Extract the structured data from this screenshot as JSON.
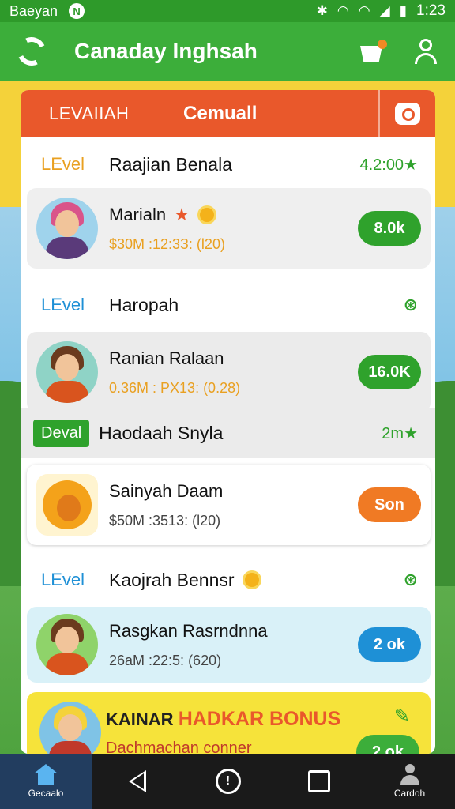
{
  "status": {
    "carrier": "Baeyan",
    "time": "1:23",
    "nfc_icon": "N"
  },
  "appbar": {
    "title": "Canaday Inghsah"
  },
  "banner": {
    "left": "LEVAIIAH",
    "middle": "Cemuall"
  },
  "sections": [
    {
      "level_label": "LEvel",
      "level_color": "#e9a021",
      "name": "Raajian Benala",
      "reward": "4.2:00★",
      "player": {
        "name": "Marialn",
        "stats": "$30M :12:3З: (l20)",
        "stats_color": "#e9a021",
        "button": "8.0k",
        "button_color": "#2fa22c",
        "card_bg": "#efefef",
        "hair_color": "#d9548a",
        "body_color": "#5a3a7a"
      }
    },
    {
      "level_label": "LEvel",
      "level_color": "#1e90d6",
      "name": "Haropah",
      "reward": "",
      "player": {
        "name": "Ranian Ralaan",
        "stats": "0.36M : PX13: (0.28)",
        "stats_color": "#e9a021",
        "button": "16.0K",
        "button_color": "#2fa22c",
        "card_bg": "#ebebeb",
        "hair_color": "#6b3b1e",
        "body_color": "#d9541e"
      }
    },
    {
      "level_label": "Deval",
      "level_color": "#ffffff",
      "name": "Haodaah  Snyla",
      "reward": "2m★",
      "player": {
        "name": "Sainyah Daam",
        "stats": "$50M :3513: (l20)",
        "stats_color": "#444444",
        "button": "Son",
        "button_color": "#f07a24",
        "card_bg": "#ffffff",
        "hair_color": "#f4a21a",
        "body_color": "#e07a1a"
      }
    },
    {
      "level_label": "LEvel",
      "level_color": "#1e90d6",
      "name": "Kaojrah Bennsr",
      "reward": "",
      "player": {
        "name": "Rasgkan Rasrndnna",
        "stats": "26aM :22:5: (620)",
        "stats_color": "#444444",
        "button": "2 ok",
        "button_color": "#1e90d6",
        "card_bg": "#d9f1f8",
        "hair_color": "#6b3b1e",
        "body_color": "#d9541e"
      }
    }
  ],
  "bonus": {
    "prefix": "KAINAR",
    "highlight": "HADKAR BONUS",
    "sub": "Dachmachan conner",
    "button": "2 ok"
  },
  "nav": {
    "home_label": "Gecaalo",
    "profile_label": "Cardoh"
  }
}
